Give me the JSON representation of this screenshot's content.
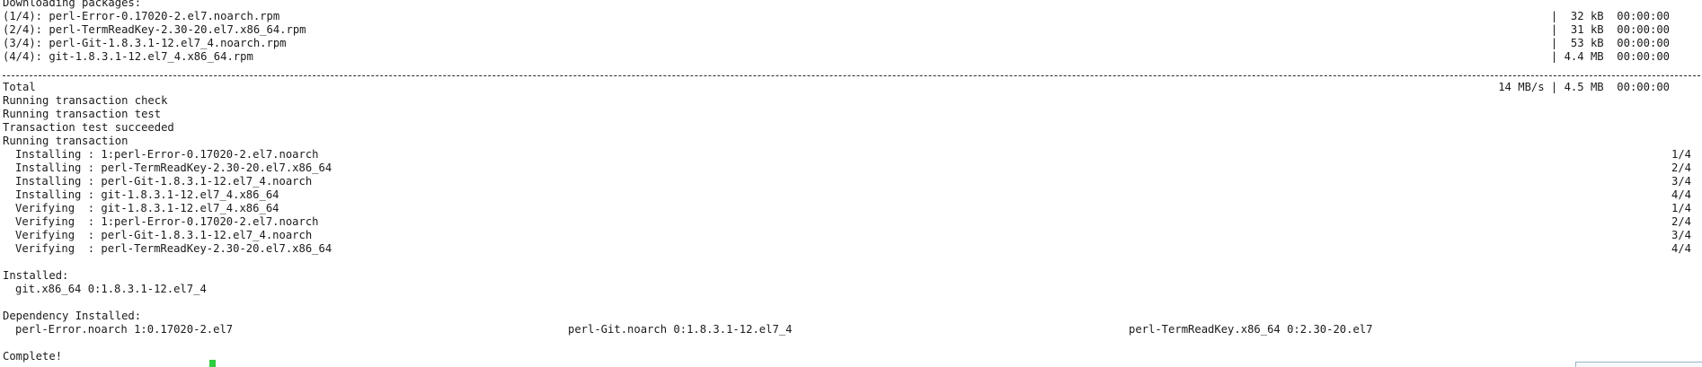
{
  "downloading": {
    "header": "Downloading packages:",
    "packages": [
      {
        "name": "(1/4): perl-Error-0.17020-2.el7.noarch.rpm",
        "stats": "|  32 kB  00:00:00"
      },
      {
        "name": "(2/4): perl-TermReadKey-2.30-20.el7.x86_64.rpm",
        "stats": "|  31 kB  00:00:00"
      },
      {
        "name": "(3/4): perl-Git-1.8.3.1-12.el7_4.noarch.rpm",
        "stats": "|  53 kB  00:00:00"
      },
      {
        "name": "(4/4): git-1.8.3.1-12.el7_4.x86_64.rpm",
        "stats": "| 4.4 MB  00:00:00"
      }
    ]
  },
  "total": {
    "label": "Total",
    "stats": "14 MB/s | 4.5 MB  00:00:00"
  },
  "transaction": {
    "messages": [
      "Running transaction check",
      "Running transaction test",
      "Transaction test succeeded",
      "Running transaction"
    ],
    "steps": [
      {
        "text": "Installing : 1:perl-Error-0.17020-2.el7.noarch",
        "count": "1/4"
      },
      {
        "text": "Installing : perl-TermReadKey-2.30-20.el7.x86_64",
        "count": "2/4"
      },
      {
        "text": "Installing : perl-Git-1.8.3.1-12.el7_4.noarch",
        "count": "3/4"
      },
      {
        "text": "Installing : git-1.8.3.1-12.el7_4.x86_64",
        "count": "4/4"
      },
      {
        "text": "Verifying  : git-1.8.3.1-12.el7_4.x86_64",
        "count": "1/4"
      },
      {
        "text": "Verifying  : 1:perl-Error-0.17020-2.el7.noarch",
        "count": "2/4"
      },
      {
        "text": "Verifying  : perl-Git-1.8.3.1-12.el7_4.noarch",
        "count": "3/4"
      },
      {
        "text": "Verifying  : perl-TermReadKey-2.30-20.el7.x86_64",
        "count": "4/4"
      }
    ]
  },
  "installed": {
    "header": "Installed:",
    "package": "git.x86_64 0:1.8.3.1-12.el7_4"
  },
  "dependency_installed": {
    "header": "Dependency Installed:",
    "packages": [
      "perl-Error.noarch 1:0.17020-2.el7",
      "perl-Git.noarch 0:1.8.3.1-12.el7_4",
      "perl-TermReadKey.x86_64 0:2.30-20.el7"
    ]
  },
  "complete": "Complete!",
  "colors": {
    "background": "#ffffff",
    "text": "#1a1a1a",
    "cursor": "#2ecc40"
  }
}
